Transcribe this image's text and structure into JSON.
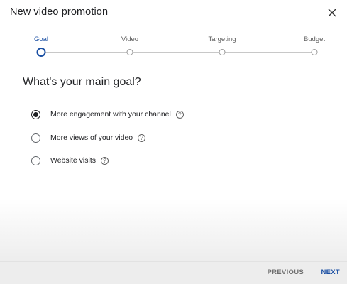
{
  "dialog": {
    "title": "New video promotion",
    "close_icon": "close-icon"
  },
  "stepper": {
    "steps": [
      {
        "label": "Goal",
        "state": "active"
      },
      {
        "label": "Video",
        "state": "inactive"
      },
      {
        "label": "Targeting",
        "state": "inactive"
      },
      {
        "label": "Budget",
        "state": "inactive"
      }
    ],
    "active_color": "#1a4fa3"
  },
  "question": "What's your main goal?",
  "options": [
    {
      "label": "More engagement with your channel",
      "selected": true,
      "help": "?"
    },
    {
      "label": "More views of your video",
      "selected": false,
      "help": "?"
    },
    {
      "label": "Website visits",
      "selected": false,
      "help": "?"
    }
  ],
  "footer": {
    "previous_label": "PREVIOUS",
    "next_label": "NEXT"
  },
  "colors": {
    "accent": "#1a4fa3",
    "text": "#202124",
    "footer_bg": "#ededed"
  }
}
